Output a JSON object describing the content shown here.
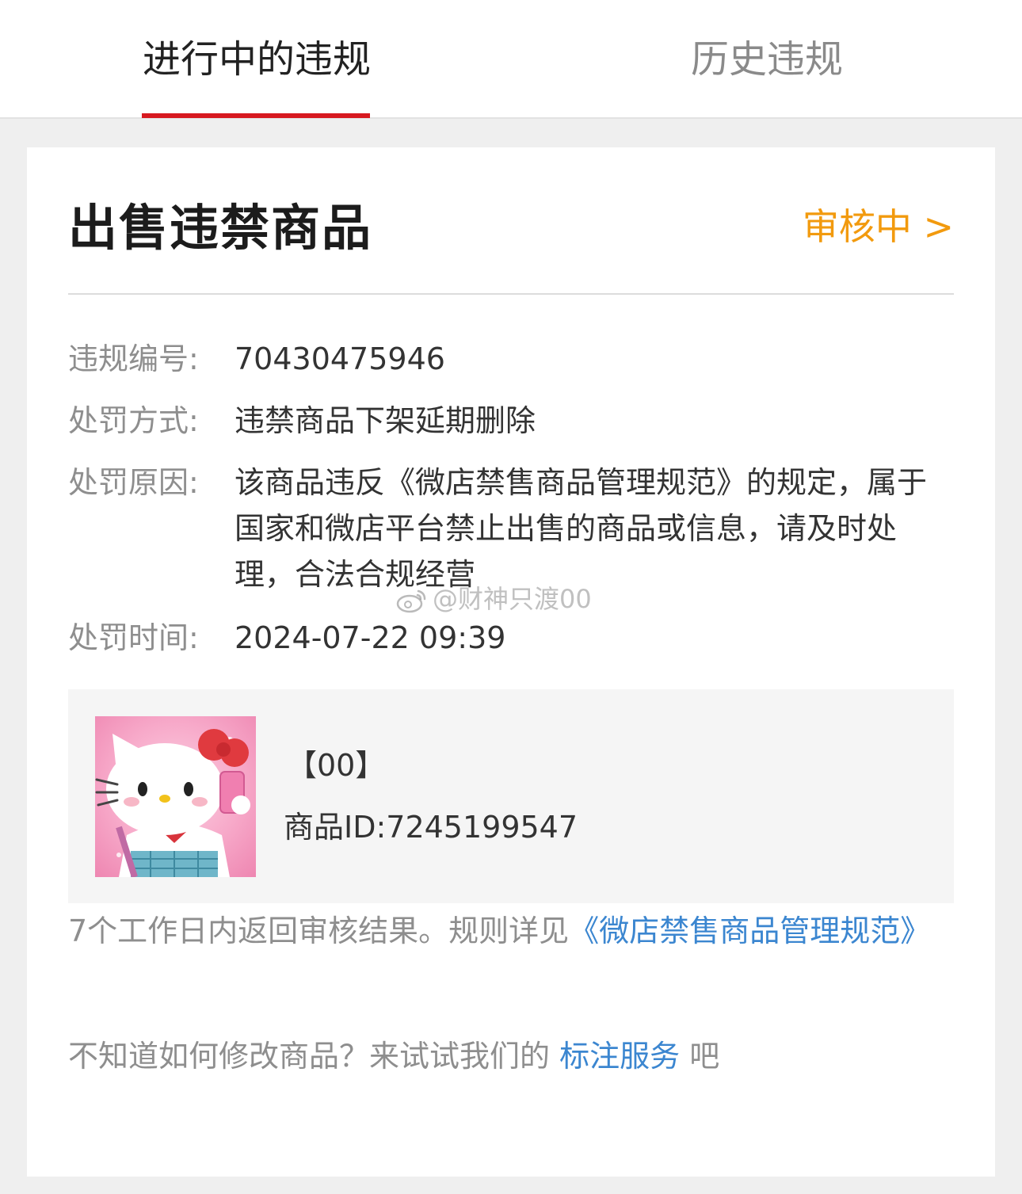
{
  "tabs": {
    "active_label": "进行中的违规",
    "inactive_label": "历史违规"
  },
  "violation": {
    "title": "出售违禁商品",
    "status": "审核中 >",
    "fields": [
      {
        "label": "违规编号:",
        "value": "70430475946"
      },
      {
        "label": "处罚方式:",
        "value": "违禁商品下架延期删除"
      },
      {
        "label": "处罚原因:",
        "value": "该商品违反《微店禁售商品管理规范》的规定，属于国家和微店平台禁止出售的商品或信息，请及时处理，合法合规经营"
      },
      {
        "label": "处罚时间:",
        "value": "2024-07-22 09:39"
      }
    ]
  },
  "product": {
    "name": "【00】",
    "id_text": "商品ID:7245199547",
    "thumbnail_icon": "hello-kitty-image"
  },
  "notice": {
    "text": "7个工作日内返回审核结果。规则详见",
    "link": "《微店禁售商品管理规范》"
  },
  "help": {
    "prefix": "不知道如何修改商品？来试试我们的 ",
    "link": "标注服务",
    "suffix": " 吧"
  },
  "watermark": {
    "text": "@财神只渡00",
    "icon": "weibo-logo-icon"
  },
  "colors": {
    "accent_red": "#d71920",
    "status_orange": "#f29a0e",
    "link_blue": "#3b86d0"
  }
}
